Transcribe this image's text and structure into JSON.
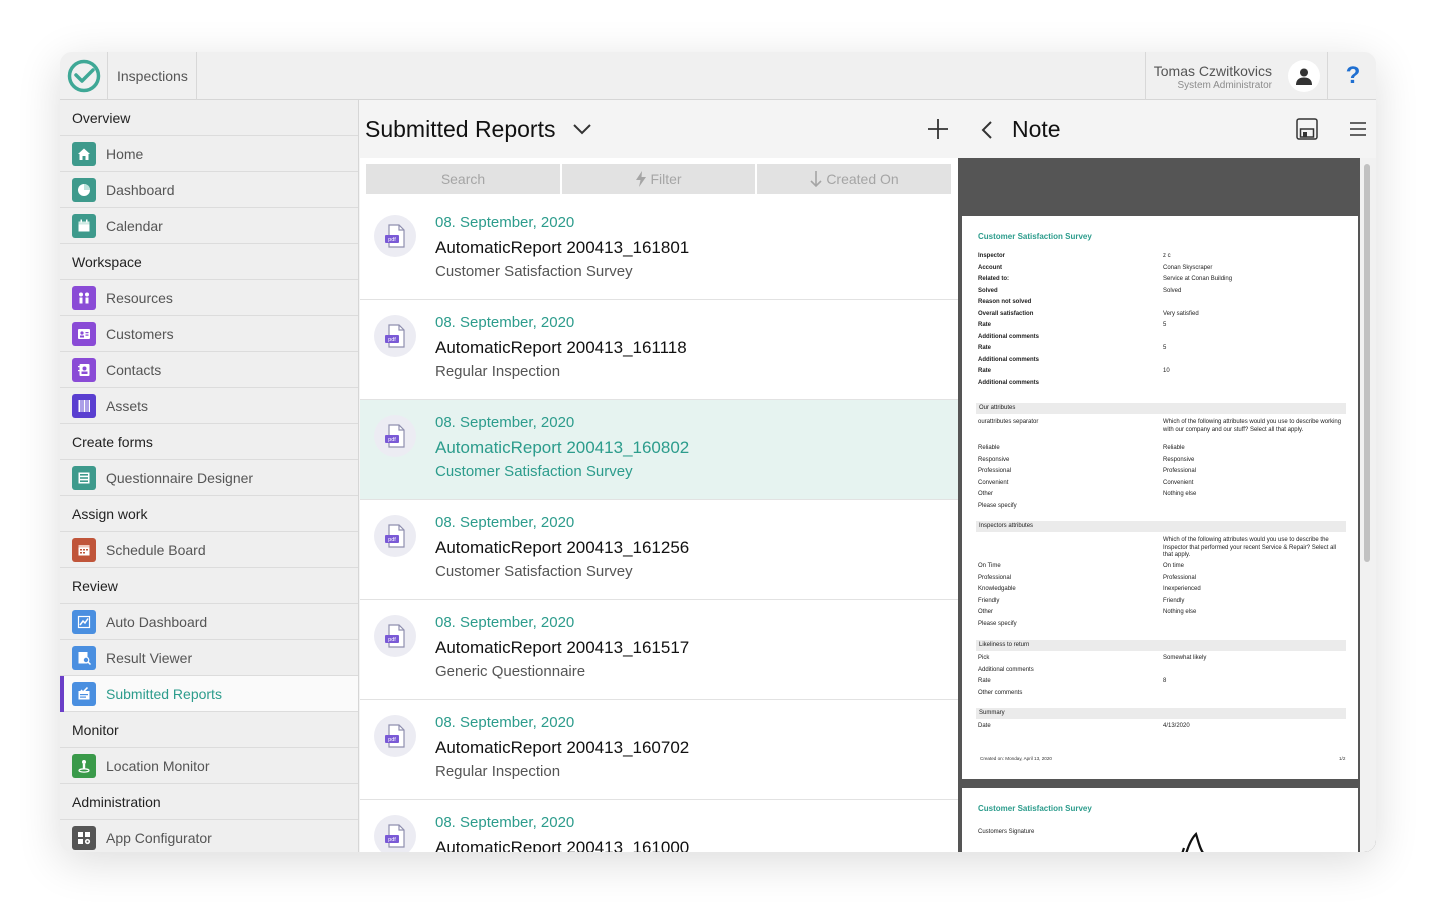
{
  "topbar": {
    "app_title": "Inspections",
    "user_name": "Tomas Czwitkovics",
    "user_role": "System Administrator",
    "help": "?"
  },
  "sidebar": {
    "sections": [
      {
        "title": "Overview",
        "items": [
          {
            "label": "Home",
            "icon": "home-icon",
            "color": "#3e9a8c"
          },
          {
            "label": "Dashboard",
            "icon": "dashboard-icon",
            "color": "#3e9a8c"
          },
          {
            "label": "Calendar",
            "icon": "calendar-icon",
            "color": "#3e9a8c"
          }
        ]
      },
      {
        "title": "Workspace",
        "items": [
          {
            "label": "Resources",
            "icon": "resources-icon",
            "color": "#8a4bd6"
          },
          {
            "label": "Customers",
            "icon": "customers-icon",
            "color": "#8a4bd6"
          },
          {
            "label": "Contacts",
            "icon": "contacts-icon",
            "color": "#8a4bd6"
          },
          {
            "label": "Assets",
            "icon": "assets-icon",
            "color": "#5a3fd0"
          }
        ]
      },
      {
        "title": "Create forms",
        "items": [
          {
            "label": "Questionnaire Designer",
            "icon": "questionnaire-designer-icon",
            "color": "#3e9a8c"
          }
        ]
      },
      {
        "title": "Assign work",
        "items": [
          {
            "label": "Schedule Board",
            "icon": "schedule-board-icon",
            "color": "#c0553a"
          }
        ]
      },
      {
        "title": "Review",
        "items": [
          {
            "label": "Auto Dashboard",
            "icon": "auto-dashboard-icon",
            "color": "#4a8fe0"
          },
          {
            "label": "Result Viewer",
            "icon": "result-viewer-icon",
            "color": "#4a8fe0"
          },
          {
            "label": "Submitted Reports",
            "icon": "submitted-reports-icon",
            "color": "#4a8fe0",
            "active": true
          }
        ]
      },
      {
        "title": "Monitor",
        "items": [
          {
            "label": "Location Monitor",
            "icon": "location-monitor-icon",
            "color": "#3a9a4a"
          }
        ]
      },
      {
        "title": "Administration",
        "items": [
          {
            "label": "App Configurator",
            "icon": "app-configurator-icon",
            "color": "#555555"
          }
        ]
      }
    ]
  },
  "list": {
    "title": "Submitted Reports",
    "search": "Search",
    "filter": "Filter",
    "sort": "Created On",
    "rows": [
      {
        "date": "08. September, 2020",
        "name": "AutomaticReport 200413_161801",
        "type": "Customer Satisfaction Survey"
      },
      {
        "date": "08. September, 2020",
        "name": "AutomaticReport 200413_161118",
        "type": "Regular Inspection"
      },
      {
        "date": "08. September, 2020",
        "name": "AutomaticReport 200413_160802",
        "type": "Customer Satisfaction Survey",
        "selected": true
      },
      {
        "date": "08. September, 2020",
        "name": "AutomaticReport 200413_161256",
        "type": "Customer Satisfaction Survey"
      },
      {
        "date": "08. September, 2020",
        "name": "AutomaticReport 200413_161517",
        "type": "Generic Questionnaire"
      },
      {
        "date": "08. September, 2020",
        "name": "AutomaticReport 200413_160702",
        "type": "Regular Inspection"
      },
      {
        "date": "08. September, 2020",
        "name": "AutomaticReport 200413_161000",
        "type": ""
      }
    ]
  },
  "note": {
    "title": "Note",
    "page1": {
      "title": "Customer Satisfaction Survey",
      "fields": [
        {
          "label": "Inspector",
          "value": "z c"
        },
        {
          "label": "Account",
          "value": "Conan Skyscraper"
        },
        {
          "label": "Related to:",
          "value": "Service at Conan Building"
        },
        {
          "label": "Solved",
          "value": "Solved"
        },
        {
          "label": "Reason not solved",
          "value": ""
        },
        {
          "label": "Overall satisfaction",
          "value": "Very satisfied"
        },
        {
          "label": "Rate",
          "value": "5"
        },
        {
          "label": "Additional comments",
          "value": ""
        },
        {
          "label": "Rate",
          "value": "5"
        },
        {
          "label": "Additional comments",
          "value": ""
        },
        {
          "label": "Rate",
          "value": "10"
        },
        {
          "label": "Additional comments",
          "value": ""
        }
      ],
      "sec_attributes": "Our attributes",
      "attributes": [
        {
          "label": "ourattributes separator",
          "value": "Which of the following attributes would you use to describe working with our company and our stuff? Select all that apply."
        },
        {
          "label": "Reliable",
          "value": "Reliable"
        },
        {
          "label": "Responsive",
          "value": "Responsive"
        },
        {
          "label": "Professional",
          "value": "Professional"
        },
        {
          "label": "Convenient",
          "value": "Convenient"
        },
        {
          "label": "Other",
          "value": "Nothing else"
        },
        {
          "label": "Please specify",
          "value": ""
        }
      ],
      "sec_inspectors": "Inspectors attributes",
      "inspectors": [
        {
          "label": "",
          "value": "Which of the following attributes would you use to describe the Inspector that performed your recent Service & Repair? Select all that apply."
        },
        {
          "label": "On Time",
          "value": "On time"
        },
        {
          "label": "Professional",
          "value": "Professional"
        },
        {
          "label": "Knowledgable",
          "value": "Inexperienced"
        },
        {
          "label": "Friendly",
          "value": "Friendly"
        },
        {
          "label": "Other",
          "value": "Nothing else"
        },
        {
          "label": "Please specify",
          "value": ""
        }
      ],
      "sec_likeliness": "Likeliness to return",
      "likeliness": [
        {
          "label": "Pick",
          "value": "Somewhat likely"
        },
        {
          "label": "Additional comments",
          "value": ""
        },
        {
          "label": "Rate",
          "value": "8"
        },
        {
          "label": "Other comments",
          "value": ""
        }
      ],
      "sec_summary": "Summary",
      "summary": [
        {
          "label": "Date",
          "value": "4/13/2020"
        }
      ],
      "footer_left": "Created on: Monday, April 13, 2020",
      "footer_right": "1/2"
    },
    "page2": {
      "title": "Customer Satisfaction Survey",
      "signature_label": "Customers Signature"
    }
  }
}
